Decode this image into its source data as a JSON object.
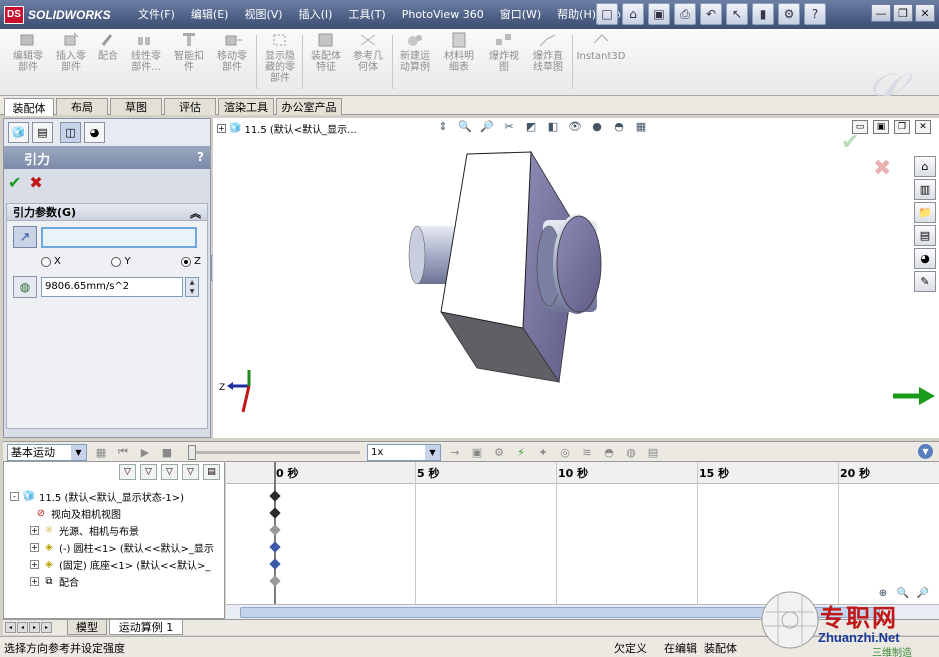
{
  "app": {
    "logo_text": "SOLIDWORKS",
    "menus": [
      "文件(F)",
      "编辑(E)",
      "视图(V)",
      "插入(I)",
      "工具(T)",
      "PhotoView 360",
      "窗口(W)",
      "帮助(H)"
    ]
  },
  "commands": [
    {
      "label": "编辑零\n部件",
      "icon": "edit-component-icon"
    },
    {
      "label": "插入零\n部件",
      "icon": "insert-component-icon"
    },
    {
      "label": "配合",
      "icon": "mate-icon"
    },
    {
      "label": "线性零\n部件...",
      "icon": "linear-pattern-icon"
    },
    {
      "label": "智能扣\n件",
      "icon": "smart-fastener-icon"
    },
    {
      "label": "移动零\n部件",
      "icon": "move-component-icon"
    },
    {
      "label": "显示隐\n藏的零\n部件",
      "icon": "show-hidden-icon"
    },
    {
      "label": "装配体\n特征",
      "icon": "assembly-feature-icon"
    },
    {
      "label": "参考几\n何体",
      "icon": "reference-geometry-icon"
    },
    {
      "label": "新建运\n动算例",
      "icon": "new-motion-study-icon"
    },
    {
      "label": "材料明\n细表",
      "icon": "bom-icon"
    },
    {
      "label": "爆炸视\n图",
      "icon": "exploded-view-icon"
    },
    {
      "label": "爆炸直\n线草图",
      "icon": "explode-line-icon"
    },
    {
      "label": "Instant3D",
      "icon": "instant3d-icon"
    }
  ],
  "tabs": [
    "装配体",
    "布局",
    "草图",
    "评估",
    "渲染工具",
    "办公室产品"
  ],
  "property_manager": {
    "title": "引力",
    "help": "?",
    "group_title": "引力参数(G)",
    "radios": [
      {
        "label": "X",
        "selected": false
      },
      {
        "label": "Y",
        "selected": false
      },
      {
        "label": "Z",
        "selected": true
      }
    ],
    "value": "9806.65mm/s^2"
  },
  "graphics": {
    "tree_label": "11.5  (默认<默认_显示..."
  },
  "motion": {
    "study_type": "基本运动",
    "rate": "1x",
    "ruler": [
      "0 秒",
      "5 秒",
      "10 秒",
      "15 秒",
      "20 秒"
    ],
    "tree": [
      {
        "text": "11.5  (默认<默认_显示状态-1>)",
        "expander": "-",
        "icon": "assembly-icon"
      },
      {
        "text": "视向及相机视图",
        "expander": "",
        "icon": "camera-view-icon"
      },
      {
        "text": "光源、相机与布景",
        "expander": "+",
        "icon": "lights-icon"
      },
      {
        "text": "(-) 圆柱<1> (默认<<默认>_显示",
        "expander": "+",
        "icon": "part-icon"
      },
      {
        "text": "(固定) 底座<1> (默认<<默认>_",
        "expander": "+",
        "icon": "part-icon"
      },
      {
        "text": "配合",
        "expander": "+",
        "icon": "mates-icon"
      }
    ],
    "bottom_tabs": [
      "模型",
      "运动算例 1"
    ]
  },
  "status": {
    "message": "选择方向参考并设定强度",
    "state": "欠定义",
    "editing": "在编辑",
    "doc_type": "装配体"
  },
  "site": {
    "name": "专职网",
    "url": "Zhuanzhi.Net",
    "tagline": "三维制造"
  },
  "colors": {
    "accent_title": "#4d5f85",
    "ok": "#1c9a1c",
    "cancel": "#c41818",
    "model_face": "#9ea4c4"
  }
}
